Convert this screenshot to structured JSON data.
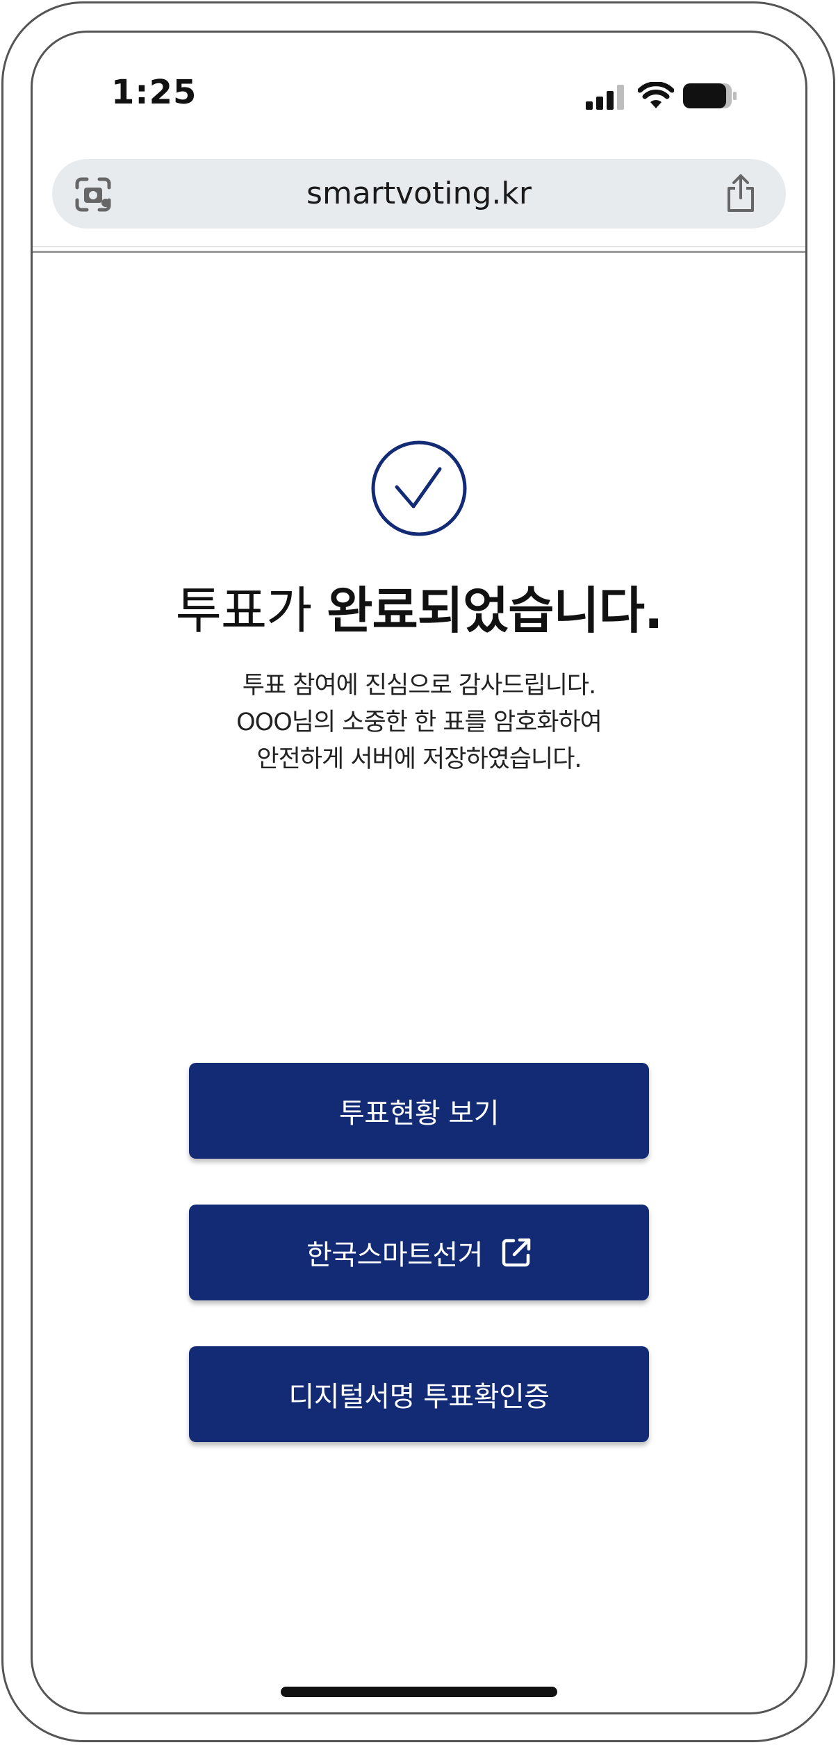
{
  "status_bar": {
    "time": "1:25",
    "icons": [
      "signal-icon",
      "wifi-icon",
      "battery-icon"
    ]
  },
  "browser": {
    "url": "smartvoting.kr",
    "icons": [
      "camera-scan-icon",
      "share-icon"
    ]
  },
  "result": {
    "icon": "check-circle-icon",
    "title_light": "투표가",
    "title_bold": "완료되었습니다.",
    "message_lines": [
      "투표 참여에 진심으로 감사드립니다.",
      "OOO님의 소중한 한 표를 암호화하여",
      "안전하게 서버에 저장하였습니다."
    ]
  },
  "buttons": {
    "view_status": "투표현황 보기",
    "korea_smart_election": "한국스마트선거",
    "digital_signature": "디지털서명 투표확인증"
  },
  "colors": {
    "primary": "#132b75",
    "text": "#111111",
    "url_bar": "#e8ebee"
  }
}
